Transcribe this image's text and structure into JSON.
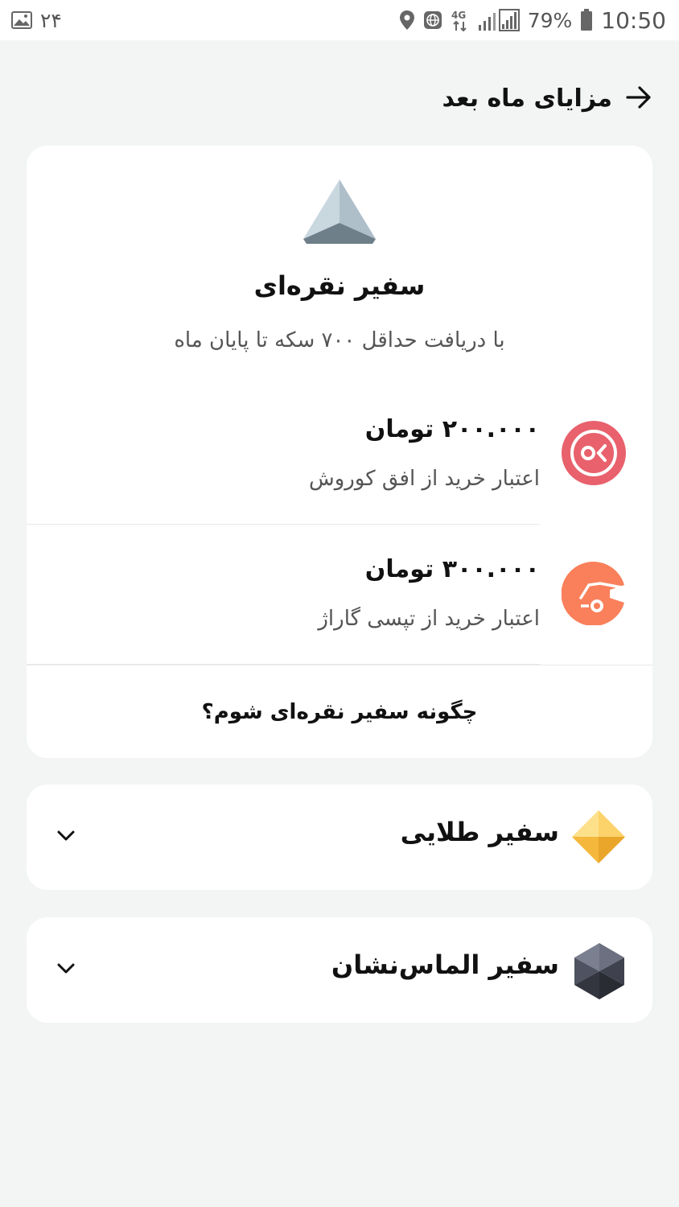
{
  "status_bar": {
    "notification_count": "۲۴",
    "network": "4G",
    "battery": "79%",
    "time": "10:50"
  },
  "header": {
    "title": "مزایای ماه بعد",
    "back_icon": "arrow-right-icon"
  },
  "silver": {
    "title": "سفیر نقره‌ای",
    "subtitle": "با دریافت حداقل ۷۰۰ سکه تا پایان ماه",
    "rewards": [
      {
        "amount": "۲۰۰.۰۰۰ تومان",
        "description": "اعتبار خرید از افق کوروش",
        "icon": "ofogh-kourosh-logo",
        "color": "#e8616c"
      },
      {
        "amount": "۳۰۰.۰۰۰ تومان",
        "description": "اعتبار خرید از تپسی گاراژ",
        "icon": "tapsi-garage-logo",
        "color": "#f9805a"
      }
    ],
    "how_to": "چگونه سفیر نقره‌ای شوم؟"
  },
  "gold": {
    "title": "سفیر طلایی"
  },
  "diamond": {
    "title": "سفیر الماس‌نشان"
  },
  "colors": {
    "background": "#f3f5f5",
    "card": "#ffffff",
    "gold": "#f5b83d",
    "diamond": "#4a4e5a",
    "silver": "#a8bcc8"
  }
}
